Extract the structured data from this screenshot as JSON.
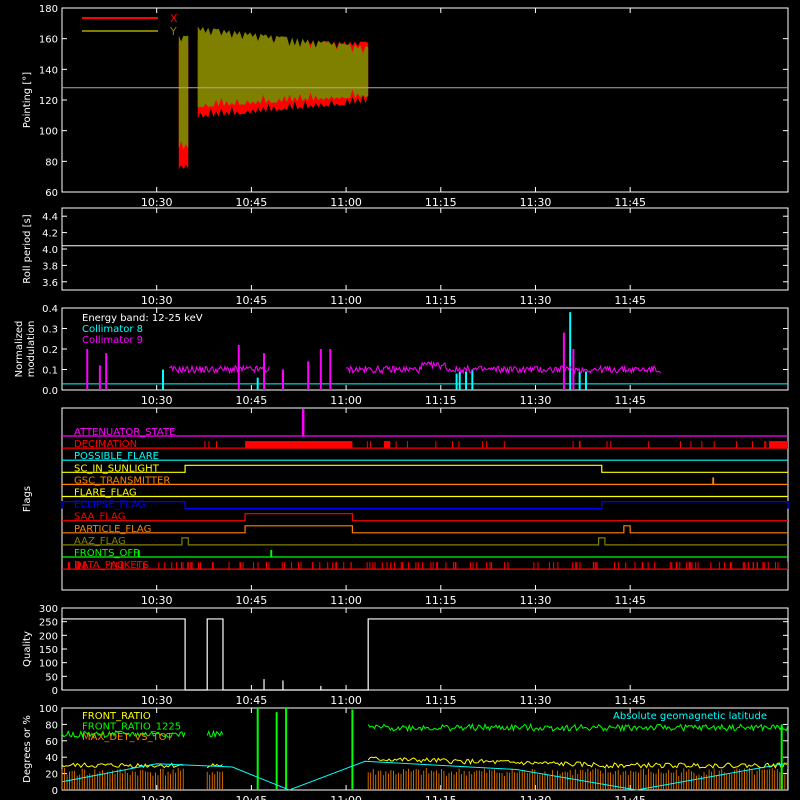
{
  "time_axis": {
    "range_min": [
      15,
      130
    ],
    "ticks": [
      {
        "t": 30,
        "label": "10:30"
      },
      {
        "t": 45,
        "label": "10:45"
      },
      {
        "t": 60,
        "label": "11:00"
      },
      {
        "t": 75,
        "label": "11:15"
      },
      {
        "t": 90,
        "label": "11:30"
      },
      {
        "t": 105,
        "label": "11:45"
      }
    ]
  },
  "chart_data": [
    {
      "id": "pointing",
      "type": "area",
      "ylabel": "Pointing [°]",
      "ylim": [
        60,
        180
      ],
      "yticks": [
        60,
        80,
        100,
        120,
        140,
        160,
        180
      ],
      "hline": 128,
      "series": [
        {
          "name": "X",
          "color": "#ff0000",
          "segments": [
            {
              "t0": 33.5,
              "t1": 35.0,
              "lo": 75,
              "hi": 158
            },
            {
              "t0": 36.5,
              "t1": 63.5,
              "lo_start": 108,
              "lo_end": 118,
              "hi_start": 160,
              "hi_end": 158
            }
          ]
        },
        {
          "name": "Y",
          "color": "#808000",
          "segments": [
            {
              "t0": 33.5,
              "t1": 35.0,
              "lo": 88,
              "hi": 162
            },
            {
              "t0": 36.5,
              "t1": 63.5,
              "lo_start": 115,
              "lo_end": 122,
              "hi_start": 168,
              "hi_end": 155
            }
          ]
        }
      ]
    },
    {
      "id": "roll",
      "type": "line",
      "ylabel": "Roll period [s]",
      "ylim": [
        3.5,
        4.5
      ],
      "yticks": [
        3.6,
        3.8,
        4.0,
        4.2,
        4.4
      ],
      "series": [
        {
          "name": "",
          "color": "#ffffff",
          "value": 4.04
        }
      ]
    },
    {
      "id": "modulation",
      "type": "line",
      "ylabel": "Normalized modulation",
      "ylim": [
        0,
        0.4
      ],
      "yticks": [
        0.0,
        0.1,
        0.2,
        0.3,
        0.4
      ],
      "legend": [
        "Energy band: 12-25 keV",
        "Collimator 8",
        "Collimator 9"
      ],
      "legend_colors": [
        "#ffffff",
        "#00ffff",
        "#ff00ff"
      ],
      "series": [
        {
          "name": "Collimator 8",
          "color": "#00ffff",
          "baseline": 0.03,
          "spikes": [
            [
              31,
              0.1
            ],
            [
              46,
              0.06
            ],
            [
              50,
              0.1
            ],
            [
              77.5,
              0.08
            ],
            [
              78,
              0.09
            ],
            [
              79,
              0.09
            ],
            [
              80,
              0.1
            ],
            [
              95.5,
              0.38
            ],
            [
              97,
              0.09
            ],
            [
              98,
              0.09
            ]
          ]
        },
        {
          "name": "Collimator 9",
          "color": "#ff00ff",
          "level": 0.1,
          "spikes": [
            [
              19,
              0.2
            ],
            [
              21,
              0.12
            ],
            [
              22,
              0.18
            ],
            [
              43,
              0.22
            ],
            [
              47,
              0.18
            ],
            [
              50,
              0.1
            ],
            [
              54,
              0.14
            ],
            [
              56,
              0.2
            ],
            [
              57.5,
              0.2
            ],
            [
              94.5,
              0.28
            ],
            [
              96,
              0.2
            ]
          ]
        }
      ]
    },
    {
      "id": "flags",
      "type": "table",
      "ylabel": "Flags",
      "rows": [
        {
          "label": "ATTENUATOR_STATE",
          "color": "#ff00ff",
          "blips": [
            [
              53,
              53.4
            ]
          ]
        },
        {
          "label": "DECIMATION",
          "color": "#ff0000",
          "blips": [
            [
              44,
              61
            ],
            [
              66,
              67
            ],
            [
              127,
              130
            ]
          ]
        },
        {
          "label": "POSSIBLE_FLARE",
          "color": "#00ffff",
          "blips": []
        },
        {
          "label": "SC_IN_SUNLIGHT",
          "color": "#ffff00",
          "steps": [
            [
              34.5,
              100.5
            ]
          ]
        },
        {
          "label": "GSC_TRANSMITTER",
          "color": "#ff8000",
          "blips": [
            [
              118,
              118.3
            ]
          ]
        },
        {
          "label": "FLARE_FLAG",
          "color": "#ffff00",
          "blips": []
        },
        {
          "label": "ECLIPSE_FLAG",
          "color": "#0000ff",
          "steps": [
            [
              15,
              34.5
            ],
            [
              100.5,
              130
            ]
          ]
        },
        {
          "label": "SAA_FLAG",
          "color": "#ff0000",
          "steps": [
            [
              44,
              61
            ]
          ]
        },
        {
          "label": "PARTICLE_FLAG",
          "color": "#ff8000",
          "steps": [
            [
              44,
              61
            ],
            [
              104,
              105
            ]
          ]
        },
        {
          "label": "AAZ_FLAG",
          "color": "#808000",
          "steps": [
            [
              34,
              35
            ],
            [
              100,
              101
            ]
          ]
        },
        {
          "label": "FRONTS_OFF",
          "color": "#00ff00",
          "blips": [
            [
              27,
              27.3
            ],
            [
              48,
              48.3
            ]
          ]
        },
        {
          "label": "DATA_PACKETS",
          "color": "#ff0000",
          "blips": []
        }
      ]
    },
    {
      "id": "quality",
      "type": "line",
      "ylabel": "Quality",
      "ylim": [
        0,
        300
      ],
      "yticks": [
        0,
        50,
        100,
        150,
        200,
        250,
        300
      ],
      "series": [
        {
          "name": "",
          "color": "#ffffff",
          "blocks": [
            [
              15,
              34.5,
              260
            ],
            [
              38,
              40.5,
              260
            ],
            [
              63.5,
              130,
              260
            ]
          ],
          "spikes": [
            [
              47,
              40
            ],
            [
              50,
              35
            ],
            [
              56,
              15
            ]
          ]
        }
      ]
    },
    {
      "id": "ratios",
      "type": "line",
      "ylabel": "Degrees or %",
      "ylim": [
        0,
        100
      ],
      "yticks": [
        0,
        20,
        40,
        60,
        80,
        100
      ],
      "legend": [
        "FRONT_RATIO",
        "FRONT_RATIO_1225",
        "MAX_DET_VS_TOT"
      ],
      "legend_colors": [
        "#ffff00",
        "#00ff00",
        "#ff8000"
      ],
      "annotation": "Absolute geomagnetic latitude",
      "annotation_color": "#00ffff",
      "series": [
        {
          "name": "FRONT_RATIO_1225",
          "color": "#00ff00",
          "level": 68
        },
        {
          "name": "FRONT_RATIO",
          "color": "#ffff00",
          "level": 30
        },
        {
          "name": "MAX_DET_VS_TOT",
          "color": "#ff8000",
          "level": 22
        },
        {
          "name": "Absolute geomagnetic latitude",
          "color": "#00ffff",
          "points": [
            [
              15,
              10
            ],
            [
              30,
              32
            ],
            [
              42,
              28
            ],
            [
              51,
              0
            ],
            [
              63,
              35
            ],
            [
              87,
              25
            ],
            [
              106,
              0
            ],
            [
              130,
              33
            ]
          ]
        }
      ]
    }
  ]
}
